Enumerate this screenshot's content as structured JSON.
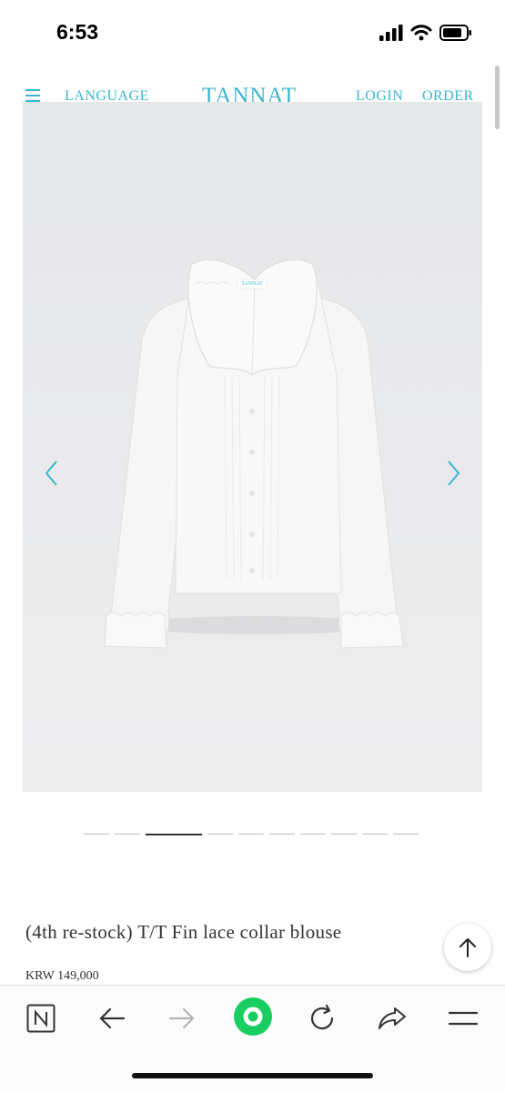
{
  "status_bar": {
    "time": "6:53"
  },
  "header": {
    "language_label": "LANGUAGE",
    "logo_text": "TANNAT",
    "login_label": "LOGIN",
    "order_label": "ORDER",
    "accent_color": "#3bb6d1"
  },
  "gallery": {
    "image": "white lace collar blouse product photo",
    "label_tag": "TANNAT",
    "slide_count": 10,
    "active_slide": 3
  },
  "product": {
    "title": "(4th re-stock) T/T Fin lace collar blouse",
    "price": "KRW 149,000"
  },
  "browser_toolbar": {
    "items": [
      "n-home-icon",
      "back-arrow-icon",
      "forward-arrow-icon",
      "green-circle-icon",
      "reload-icon",
      "share-icon",
      "menu-icon"
    ],
    "green_color": "#19ce60"
  }
}
